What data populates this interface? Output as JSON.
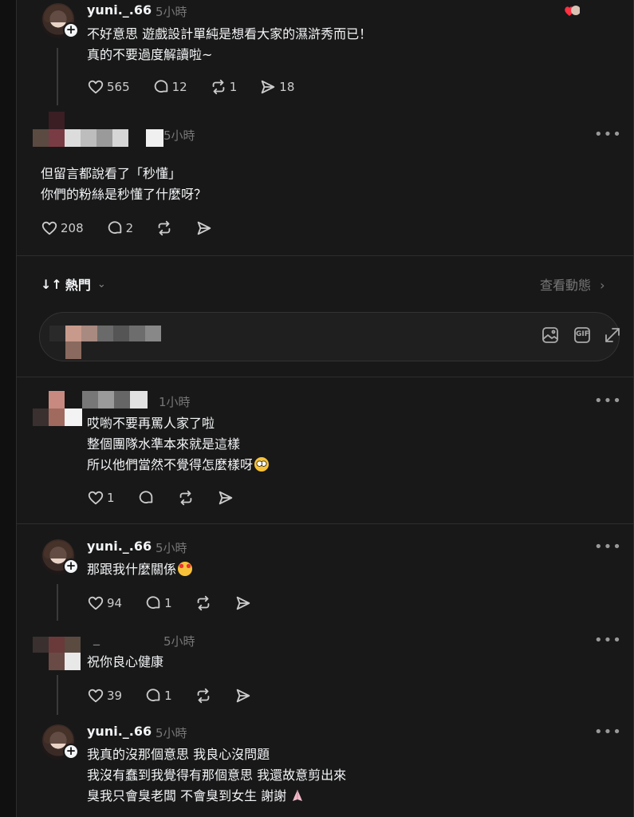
{
  "posts": [
    {
      "username": "yuni._.66",
      "time": "5小時",
      "lines": [
        "不好意思 遊戲設計單純是想看大家的濕滸秀而已！",
        "真的不要過度解讀啦~"
      ],
      "likes": "565",
      "replies": "12",
      "reposts": "1",
      "shares": "18"
    },
    {
      "username": "",
      "time": "5小時",
      "lines": [
        "但留言都說看了「秒懂」",
        "你們的粉絲是秒懂了什麼呀？"
      ],
      "likes": "208",
      "replies": "2"
    },
    {
      "username": "",
      "time": "1小時",
      "lines": [
        "哎喲不要再罵人家了啦",
        "整個團隊水準本來就是這樣",
        "所以他們當然不覺得怎麼樣呀"
      ],
      "likes": "1"
    },
    {
      "username": "yuni._.66",
      "time": "5小時",
      "lines": [
        "那跟我什麼關係"
      ],
      "likes": "94",
      "replies": "1"
    },
    {
      "username": "_",
      "time": "5小時",
      "lines": [
        "祝你良心健康"
      ],
      "likes": "39",
      "replies": "1"
    },
    {
      "username": "yuni._.66",
      "time": "5小時",
      "lines": [
        "我真的沒那個意思 我良心沒問題",
        "我沒有蠢到我覺得有那個意思 我還故意剪出來",
        "臭我只會臭老闆 不會臭到女生 謝謝"
      ]
    }
  ],
  "sort": {
    "label": "熱門",
    "view_activity": "查看動態"
  },
  "reply_box": {
    "gif_label": "GIF"
  },
  "icons": {
    "like": "heart-icon",
    "reply": "comment-icon",
    "repost": "repost-icon",
    "share": "send-icon",
    "more": "more-icon",
    "image": "image-icon",
    "gif": "gif-icon",
    "expand": "expand-icon"
  },
  "colors": {
    "background": "#181818",
    "text": "#f3f5f7",
    "muted": "#777777",
    "heart": "#ff3040"
  }
}
